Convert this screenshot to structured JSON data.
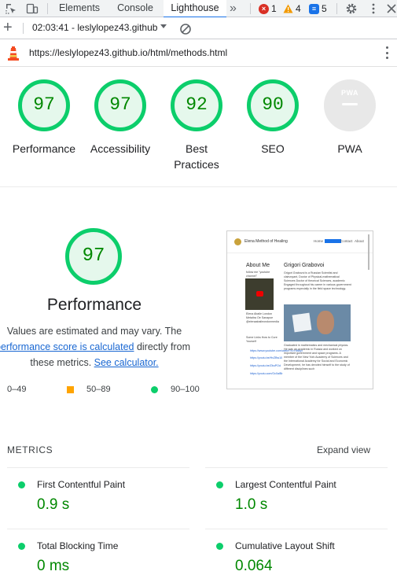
{
  "devtools": {
    "tabs": [
      "Elements",
      "Console",
      "Lighthouse"
    ],
    "active_tab": "Lighthouse",
    "more_tabs_glyph": "»",
    "errors_count": "1",
    "warnings_count": "4",
    "messages_count": "5"
  },
  "lighthouse_toolbar": {
    "add_glyph": "+",
    "report_selected": "02:03:41 - leslylopez43.github"
  },
  "url": "https://leslylopez43.github.io/html/methods.html",
  "gauges": [
    {
      "score": "97",
      "label": "Performance"
    },
    {
      "score": "97",
      "label": "Accessibility"
    },
    {
      "score": "92",
      "label": "Best Practices"
    },
    {
      "score": "90",
      "label": "SEO"
    },
    {
      "score": "",
      "label": "PWA",
      "badge_text": "PWA"
    }
  ],
  "performance": {
    "score": "97",
    "title": "Performance",
    "desc_line1": "Values are estimated and may vary. The",
    "desc_link1": "performance score is calculated",
    "desc_line2_rest": " directly from",
    "desc_line3_pre": "these metrics. ",
    "desc_link2": "See calculator.",
    "legend": {
      "fail": "0–49",
      "average": "50–89",
      "pass": "90–100"
    },
    "colors": {
      "pass": "#0cce6b",
      "average": "#ffa400",
      "fail": "#ff4e42",
      "pass_text": "#008800"
    }
  },
  "thumbnail": {
    "site_title": "Elena Method of Healing",
    "nav": [
      "Home",
      "Methods",
      "Contact",
      "About"
    ],
    "sidebar_heading": "About Me",
    "sidebar_text": "follow me \"youtube channel\"",
    "sidebar_caption": "Elena Abaile London Metaitra Oe Sanapoe @elenaabaileondonmedia",
    "sidebar_links_title": "Some Links How to Cure Yourself",
    "main_heading": "Grigori Grabovoi",
    "main_text": "Grigori Grabovoi is a Russian Scientist and clairvoyant, Doctor of Physical-mathematical Sciences Doctor of theorical Sciences, academic Engaged throughout his career in various government programs especially in the field space technology.",
    "main_text2": "Graduated in mathematics and mechanical physics. He was an academic in Russia and worked on important government and space programs. A member of the New York Academy of Sciences and the International Academy for Social and Economic Development, he has devoted himself to the study of different disciplines such",
    "links": [
      "https://www.youtube.com/watch?v=Hi8kyx",
      "https://youtu.be/HxZBw10",
      "https://youtu.be/ZbuPOd",
      "https://youtu.com/Oc0aIBr"
    ]
  },
  "metrics": {
    "title": "METRICS",
    "expand_label": "Expand view",
    "items": [
      {
        "label": "First Contentful Paint",
        "value": "0.9 s"
      },
      {
        "label": "Largest Contentful Paint",
        "value": "1.0 s"
      },
      {
        "label": "Total Blocking Time",
        "value": "0 ms"
      },
      {
        "label": "Cumulative Layout Shift",
        "value": "0.064"
      }
    ]
  }
}
